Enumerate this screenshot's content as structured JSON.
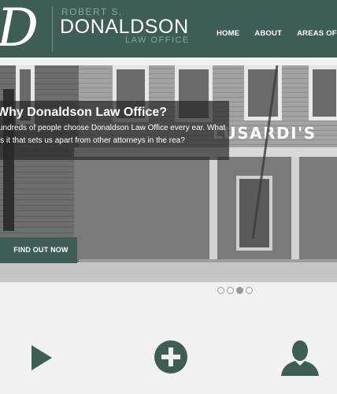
{
  "header": {
    "logo_letter": "D",
    "firm_top": "ROBERT S.",
    "firm_name": "DONALDSON",
    "firm_sub": "LAW OFFICE",
    "nav": [
      "HOME",
      "ABOUT",
      "AREAS OF P"
    ]
  },
  "hero": {
    "storefront_sign": "LUSARDI'S",
    "title": "Why Donaldson Law Office?",
    "body": "undreds of people choose Donaldson Law Office every ear. What is it that sets us apart from other attorneys in the rea?",
    "cta_label": "FIND OUT NOW"
  },
  "carousel": {
    "slides": 4,
    "active_index": 2
  },
  "features": {
    "icons": [
      "play-icon",
      "plus-circle-icon",
      "user-icon"
    ],
    "accent": "#3e5e55"
  }
}
